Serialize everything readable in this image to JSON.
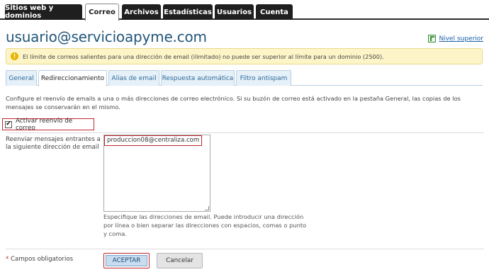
{
  "top_tabs": [
    {
      "label": "Sitios web y dominios",
      "active": false
    },
    {
      "label": "Correo",
      "active": true
    },
    {
      "label": "Archivos",
      "active": false
    },
    {
      "label": "Estadísticas",
      "active": false
    },
    {
      "label": "Usuarios",
      "active": false
    },
    {
      "label": "Cuenta",
      "active": false
    }
  ],
  "header": {
    "title": "usuario@servicioapyme.com",
    "up_link": "Nivel superior"
  },
  "warning": {
    "icon": "exclamation-icon",
    "text": "El límite de correos salientes para una dirección de email (ilimitado) no puede ser superior al límite para un dominio (2500)."
  },
  "sub_tabs": [
    {
      "label": "General",
      "active": false
    },
    {
      "label": "Redireccionamiento",
      "active": true
    },
    {
      "label": "Alias de email",
      "active": false
    },
    {
      "label": "Respuesta automática",
      "active": false
    },
    {
      "label": "Filtro antispam",
      "active": false
    }
  ],
  "form": {
    "description": "Configure el reenvío de emails a una o más direcciones de correo electrónico. Si su buzón de correo está activado en la pestaña General, las copias de los mensajes se conservarán en el mismo.",
    "enable_forwarding_label": "Activar reenvío de correo",
    "enable_forwarding_checked": true,
    "checkmark": "✔",
    "forward_label": "Reenviar mensajes entrantes a la siguiente dirección de email",
    "forward_value": "produccion08@centraliza.com",
    "help_text": "Especifique las direcciones de email. Puede introducir una dirección por línea o bien separar las direcciones con espacios, comas o punto y coma."
  },
  "footer": {
    "required_star": "*",
    "required_text": "Campos obligatorios",
    "accept_label": "ACEPTAR",
    "cancel_label": "Cancelar"
  },
  "colors": {
    "title": "#22567a",
    "highlight_border": "#c0272d",
    "tab_bar": "#1f1f1f",
    "warning_bg": "#fdf5c8"
  }
}
